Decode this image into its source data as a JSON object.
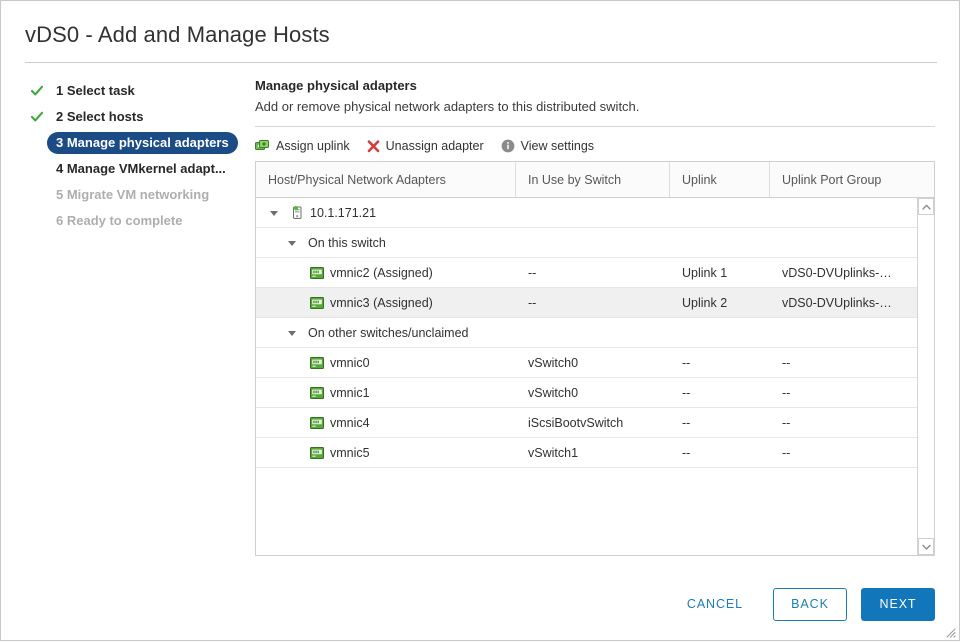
{
  "dialog": {
    "title": "vDS0 - Add and Manage Hosts"
  },
  "steps": [
    {
      "label": "1 Select task",
      "state": "done"
    },
    {
      "label": "2 Select hosts",
      "state": "done"
    },
    {
      "label": "3 Manage physical adapters",
      "state": "active"
    },
    {
      "label": "4 Manage VMkernel adapt...",
      "state": "todo"
    },
    {
      "label": "5 Migrate VM networking",
      "state": "disabled"
    },
    {
      "label": "6 Ready to complete",
      "state": "disabled"
    }
  ],
  "pane": {
    "title": "Manage physical adapters",
    "subtitle": "Add or remove physical network adapters to this distributed switch."
  },
  "toolbar": {
    "assign_uplink": "Assign uplink",
    "unassign_adapter": "Unassign adapter",
    "view_settings": "View settings"
  },
  "table": {
    "columns": [
      "Host/Physical Network Adapters",
      "In Use by Switch",
      "Uplink",
      "Uplink Port Group"
    ],
    "rows": [
      {
        "type": "host",
        "icon": "host-icon",
        "name": "10.1.171.21",
        "in_use": "",
        "uplink": "",
        "port_group": "",
        "selected": false
      },
      {
        "type": "group",
        "icon": "",
        "name": "On this switch",
        "in_use": "",
        "uplink": "",
        "port_group": "",
        "selected": false
      },
      {
        "type": "nic",
        "icon": "nic-icon",
        "name": "vmnic2 (Assigned)",
        "in_use": "--",
        "uplink": "Uplink 1",
        "port_group": "vDS0-DVUplinks-…",
        "selected": false
      },
      {
        "type": "nic",
        "icon": "nic-icon",
        "name": "vmnic3 (Assigned)",
        "in_use": "--",
        "uplink": "Uplink 2",
        "port_group": "vDS0-DVUplinks-…",
        "selected": true
      },
      {
        "type": "group",
        "icon": "",
        "name": "On other switches/unclaimed",
        "in_use": "",
        "uplink": "",
        "port_group": "",
        "selected": false
      },
      {
        "type": "nic",
        "icon": "nic-icon",
        "name": "vmnic0",
        "in_use": "vSwitch0",
        "uplink": "--",
        "port_group": "--",
        "selected": false
      },
      {
        "type": "nic",
        "icon": "nic-icon",
        "name": "vmnic1",
        "in_use": "vSwitch0",
        "uplink": "--",
        "port_group": "--",
        "selected": false
      },
      {
        "type": "nic",
        "icon": "nic-icon",
        "name": "vmnic4",
        "in_use": "iScsiBootvSwitch",
        "uplink": "--",
        "port_group": "--",
        "selected": false
      },
      {
        "type": "nic",
        "icon": "nic-icon",
        "name": "vmnic5",
        "in_use": "vSwitch1",
        "uplink": "--",
        "port_group": "--",
        "selected": false
      }
    ]
  },
  "footer": {
    "cancel": "CANCEL",
    "back": "BACK",
    "next": "NEXT"
  },
  "colors": {
    "active_step_bg": "#1b4c86",
    "primary_button": "#1177ba",
    "link": "#1a7eb8",
    "check_green": "#3aab3a",
    "unassign_red": "#d23c3c",
    "nic_green": "#5aa83c",
    "selected_row": "#f0f0f0"
  }
}
